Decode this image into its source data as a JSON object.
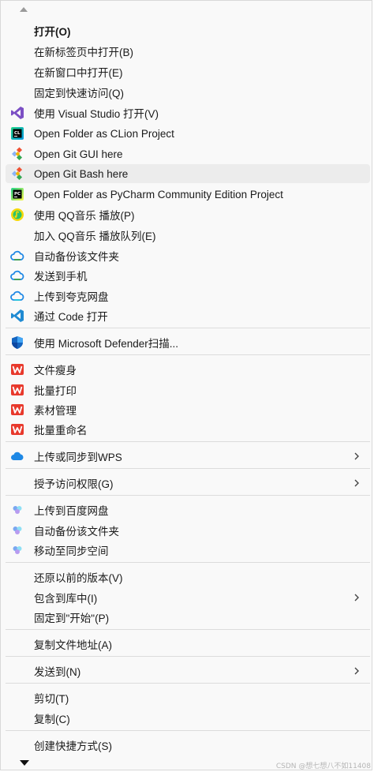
{
  "menu": {
    "items": [
      {
        "label": "打开(O)",
        "icon": "none"
      },
      {
        "label": "在新标签页中打开(B)",
        "icon": "none"
      },
      {
        "label": "在新窗口中打开(E)",
        "icon": "none"
      },
      {
        "label": "固定到快速访问(Q)",
        "icon": "none"
      },
      {
        "label": "使用 Visual Studio 打开(V)",
        "icon": "visual-studio-icon"
      },
      {
        "label": "Open Folder as CLion Project",
        "icon": "clion-icon"
      },
      {
        "label": "Open Git GUI here",
        "icon": "git-gui-icon"
      },
      {
        "label": "Open Git Bash here",
        "icon": "git-bash-icon"
      },
      {
        "label": "Open Folder as PyCharm Community Edition Project",
        "icon": "pycharm-icon"
      },
      {
        "label": "使用 QQ音乐 播放(P)",
        "icon": "qq-music-icon"
      },
      {
        "label": "加入 QQ音乐 播放队列(E)",
        "icon": "none"
      },
      {
        "label": "自动备份该文件夹",
        "icon": "baidu-cloud-icon"
      },
      {
        "label": "发送到手机",
        "icon": "baidu-cloud-icon"
      },
      {
        "label": "上传到夸克网盘",
        "icon": "quark-cloud-icon"
      },
      {
        "label": "通过 Code 打开",
        "icon": "vscode-icon"
      },
      {
        "label": "使用 Microsoft Defender扫描...",
        "icon": "defender-shield-icon"
      },
      {
        "label": "文件瘦身",
        "icon": "wps-icon"
      },
      {
        "label": "批量打印",
        "icon": "wps-icon"
      },
      {
        "label": "素材管理",
        "icon": "wps-icon"
      },
      {
        "label": "批量重命名",
        "icon": "wps-icon"
      },
      {
        "label": "上传或同步到WPS",
        "icon": "wps-cloud-icon"
      },
      {
        "label": "授予访问权限(G)",
        "icon": "none"
      },
      {
        "label": "上传到百度网盘",
        "icon": "baidu-netdisk-icon"
      },
      {
        "label": "自动备份该文件夹",
        "icon": "baidu-netdisk-icon"
      },
      {
        "label": "移动至同步空间",
        "icon": "baidu-netdisk-icon"
      },
      {
        "label": "还原以前的版本(V)",
        "icon": "none"
      },
      {
        "label": "包含到库中(I)",
        "icon": "none"
      },
      {
        "label": "固定到\"开始\"(P)",
        "icon": "none"
      },
      {
        "label": "复制文件地址(A)",
        "icon": "none"
      },
      {
        "label": "发送到(N)",
        "icon": "none"
      },
      {
        "label": "剪切(T)",
        "icon": "none"
      },
      {
        "label": "复制(C)",
        "icon": "none"
      },
      {
        "label": "创建快捷方式(S)",
        "icon": "none"
      }
    ],
    "hovered_item": "Open Git Bash here",
    "submenu_items": [
      "上传或同步到WPS",
      "授予访问权限(G)",
      "包含到库中(I)",
      "发送到(N)"
    ]
  },
  "watermark": "CSDN @想七想八不如11408",
  "colors": {
    "menu_bg": "#f9f9f9",
    "hover_bg": "#ececec",
    "separator": "#dcdcdc",
    "wps_red": "#e8392c",
    "vs_purple": "#7b4fc4",
    "vscode_blue": "#1f8ad2"
  }
}
